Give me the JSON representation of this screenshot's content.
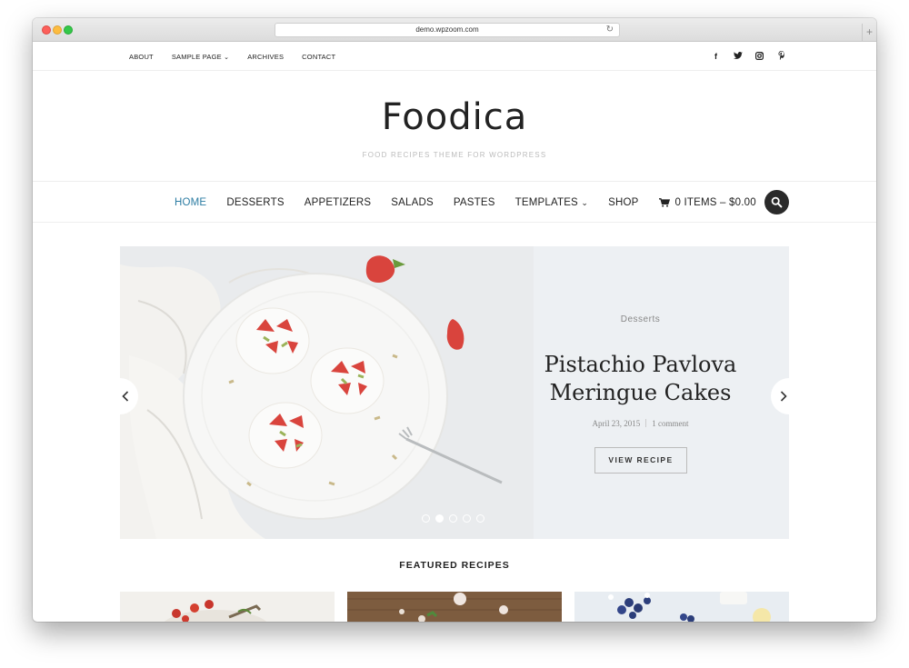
{
  "browser": {
    "url": "demo.wpzoom.com"
  },
  "topbar": {
    "links": [
      "ABOUT",
      "SAMPLE PAGE",
      "ARCHIVES",
      "CONTACT"
    ],
    "social": [
      "f",
      "t",
      "ig",
      "p"
    ]
  },
  "site": {
    "logo": "Foodica",
    "tagline": "FOOD RECIPES THEME FOR WORDPRESS"
  },
  "mainnav": {
    "items": [
      "HOME",
      "DESSERTS",
      "APPETIZERS",
      "SALADS",
      "PASTES",
      "TEMPLATES"
    ],
    "shop": "SHOP",
    "cart": "0 ITEMS – $0.00"
  },
  "slide": {
    "category": "Desserts",
    "title": "Pistachio Pavlova Meringue Cakes",
    "date": "April 23, 2015",
    "comments": "1 comment",
    "button": "VIEW RECIPE",
    "active_dot": 1,
    "dot_count": 5
  },
  "featured": {
    "title": "FEATURED RECIPES"
  },
  "colors": {
    "accent": "#2d7da3",
    "dark": "#222222"
  }
}
